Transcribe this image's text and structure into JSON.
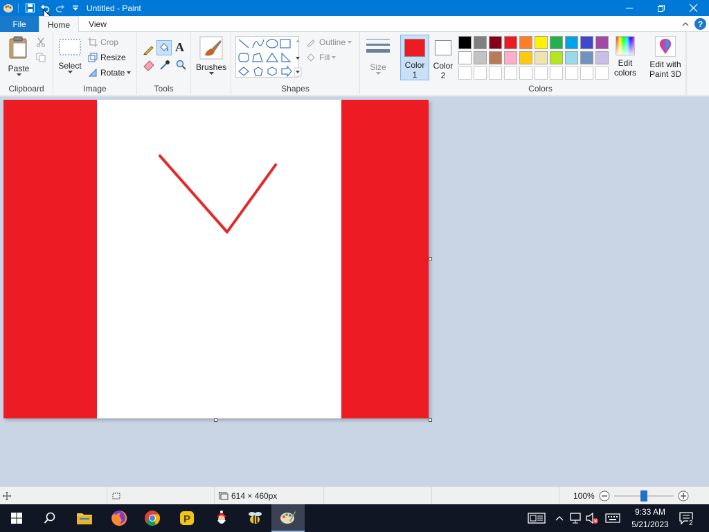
{
  "window": {
    "title": "Untitled - Paint"
  },
  "tabs": {
    "file": "File",
    "home": "Home",
    "view": "View"
  },
  "clipboard": {
    "paste": "Paste",
    "group": "Clipboard"
  },
  "image": {
    "select": "Select",
    "crop": "Crop",
    "resize": "Resize",
    "rotate": "Rotate",
    "group": "Image"
  },
  "tools": {
    "group": "Tools"
  },
  "brushes": {
    "label": "Brushes"
  },
  "shapes": {
    "outline": "Outline",
    "fill": "Fill",
    "group": "Shapes"
  },
  "size": {
    "label": "Size"
  },
  "color1": {
    "label": "Color",
    "num": "1",
    "value": "#ed1c24"
  },
  "color2": {
    "label": "Color",
    "num": "2",
    "value": "#ffffff"
  },
  "colors": {
    "group": "Colors",
    "row1": [
      "#000000",
      "#7f7f7f",
      "#880015",
      "#ed1c24",
      "#ff7f27",
      "#fff200",
      "#22b14c",
      "#00a2e8",
      "#3f48cc",
      "#a349a4"
    ],
    "row2": [
      "#ffffff",
      "#c3c3c3",
      "#b97a57",
      "#ffaec9",
      "#ffc90e",
      "#efe4b0",
      "#b5e61d",
      "#99d9ea",
      "#7092be",
      "#c8bfe7"
    ],
    "row3": [
      "#ffffff",
      "#ffffff",
      "#ffffff",
      "#ffffff",
      "#ffffff",
      "#ffffff",
      "#ffffff",
      "#ffffff",
      "#ffffff",
      "#ffffff"
    ],
    "edit_line1": "Edit",
    "edit_line2": "colors"
  },
  "paint3d": {
    "line1": "Edit with",
    "line2": "Paint 3D"
  },
  "canvas": {
    "band_color": "#ed1c24",
    "stroke_color": "#e32a2a"
  },
  "status": {
    "dimensions": "614 × 460px",
    "zoom": "100%",
    "zoom_level": 0.5
  },
  "taskbar": {
    "time": "9:33 AM",
    "date": "5/21/2023",
    "notifications": "2"
  }
}
